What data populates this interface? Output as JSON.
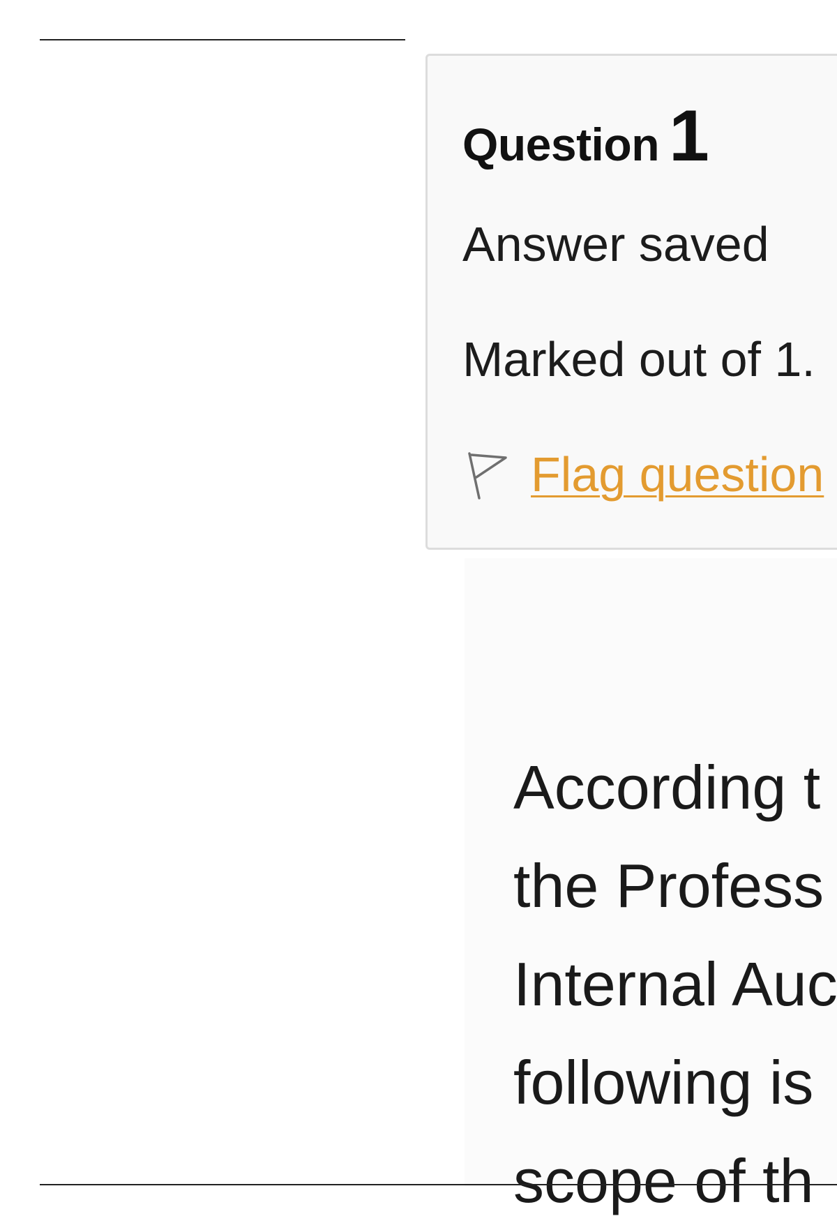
{
  "question_info": {
    "label": "Question",
    "number": "1",
    "state": "Answer saved",
    "grade": "Marked out of 1.",
    "flag_label": "Flag question",
    "flag_icon": "flag-icon"
  },
  "question_text": {
    "lines": [
      "According t",
      "the Profess",
      "Internal Auc",
      "following is",
      "scope of th"
    ]
  }
}
